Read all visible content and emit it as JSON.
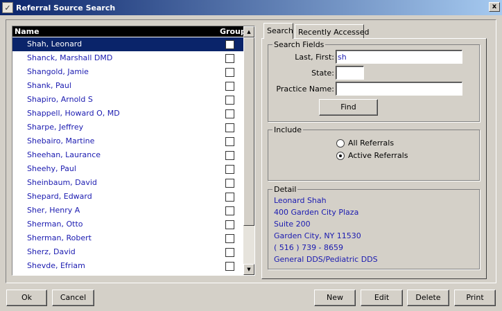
{
  "window": {
    "title": "Referral Source Search",
    "close_label": "x"
  },
  "list": {
    "header_name": "Name",
    "header_group": "Group",
    "rows": [
      {
        "name": "Shah, Leonard",
        "selected": true
      },
      {
        "name": "Shanck, Marshall DMD"
      },
      {
        "name": "Shangold, Jamie"
      },
      {
        "name": "Shank, Paul"
      },
      {
        "name": "Shapiro, Arnold S"
      },
      {
        "name": "Shappell, Howard O, MD"
      },
      {
        "name": "Sharpe, Jeffrey"
      },
      {
        "name": "Shebairo, Martine"
      },
      {
        "name": "Sheehan, Laurance"
      },
      {
        "name": "Sheehy, Paul"
      },
      {
        "name": "Sheinbaum, David"
      },
      {
        "name": "Shepard, Edward"
      },
      {
        "name": "Sher, Henry A"
      },
      {
        "name": "Sherman, Otto"
      },
      {
        "name": "Sherman, Robert"
      },
      {
        "name": "Sherz, David"
      },
      {
        "name": "Shevde, Efriam"
      }
    ]
  },
  "tabs": {
    "search": "Search",
    "recently_accessed": "Recently Accessed"
  },
  "search_fields": {
    "legend": "Search Fields",
    "last_first_label": "Last, First:",
    "last_first_value": "sh",
    "state_label": "State:",
    "state_value": "",
    "practice_label": "Practice Name:",
    "practice_value": "",
    "find_label": "Find"
  },
  "include": {
    "legend": "Include",
    "all_label": "All Referrals",
    "active_label": "Active Referrals",
    "selected": "active"
  },
  "detail": {
    "legend": "Detail",
    "lines": [
      "Leonard Shah",
      "400 Garden City Plaza",
      "Suite 200",
      "Garden City,  NY  11530",
      "( 516 ) 739 - 8659",
      "General DDS/Pediatric DDS"
    ]
  },
  "buttons": {
    "ok": "Ok",
    "cancel": "Cancel",
    "new": "New",
    "edit": "Edit",
    "delete": "Delete",
    "print": "Print"
  },
  "icons": {
    "app": "referral-app-icon",
    "scroll_up": "arrow-up-icon",
    "scroll_down": "arrow-down-icon"
  }
}
